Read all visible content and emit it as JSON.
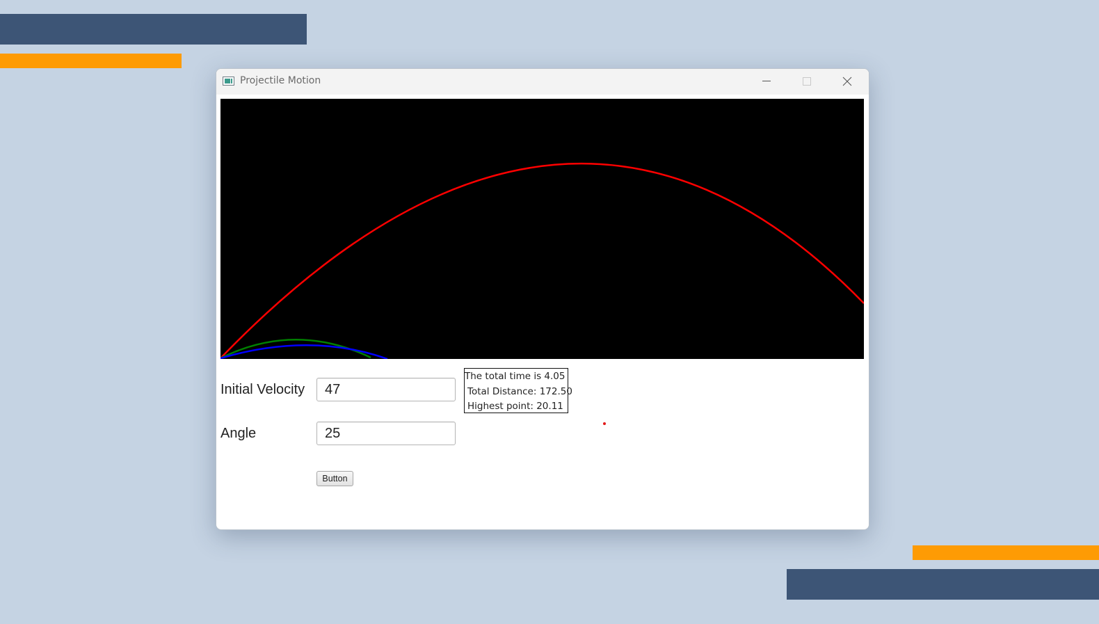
{
  "window": {
    "title": "Projectile Motion",
    "title_icon": "app-window-icon",
    "controls": [
      "minimize-icon",
      "maximize-icon",
      "close-icon"
    ]
  },
  "form": {
    "velocity_label": "Initial Velocity",
    "velocity_value": "47",
    "angle_label": "Angle",
    "angle_value": "25",
    "button_label": "Button"
  },
  "results": {
    "time_line": "The total time is 4.05",
    "distance_line": "Total Distance: 172.50",
    "height_line": "Highest point: 20.11"
  },
  "trajectories": {
    "colors": [
      "#ff0000",
      "#008000",
      "#0000ff"
    ],
    "background": "#000000"
  },
  "colors": {
    "desktop": "#c5d3e3",
    "accent_navy": "#3d5576",
    "accent_orange": "#fe9b04"
  }
}
